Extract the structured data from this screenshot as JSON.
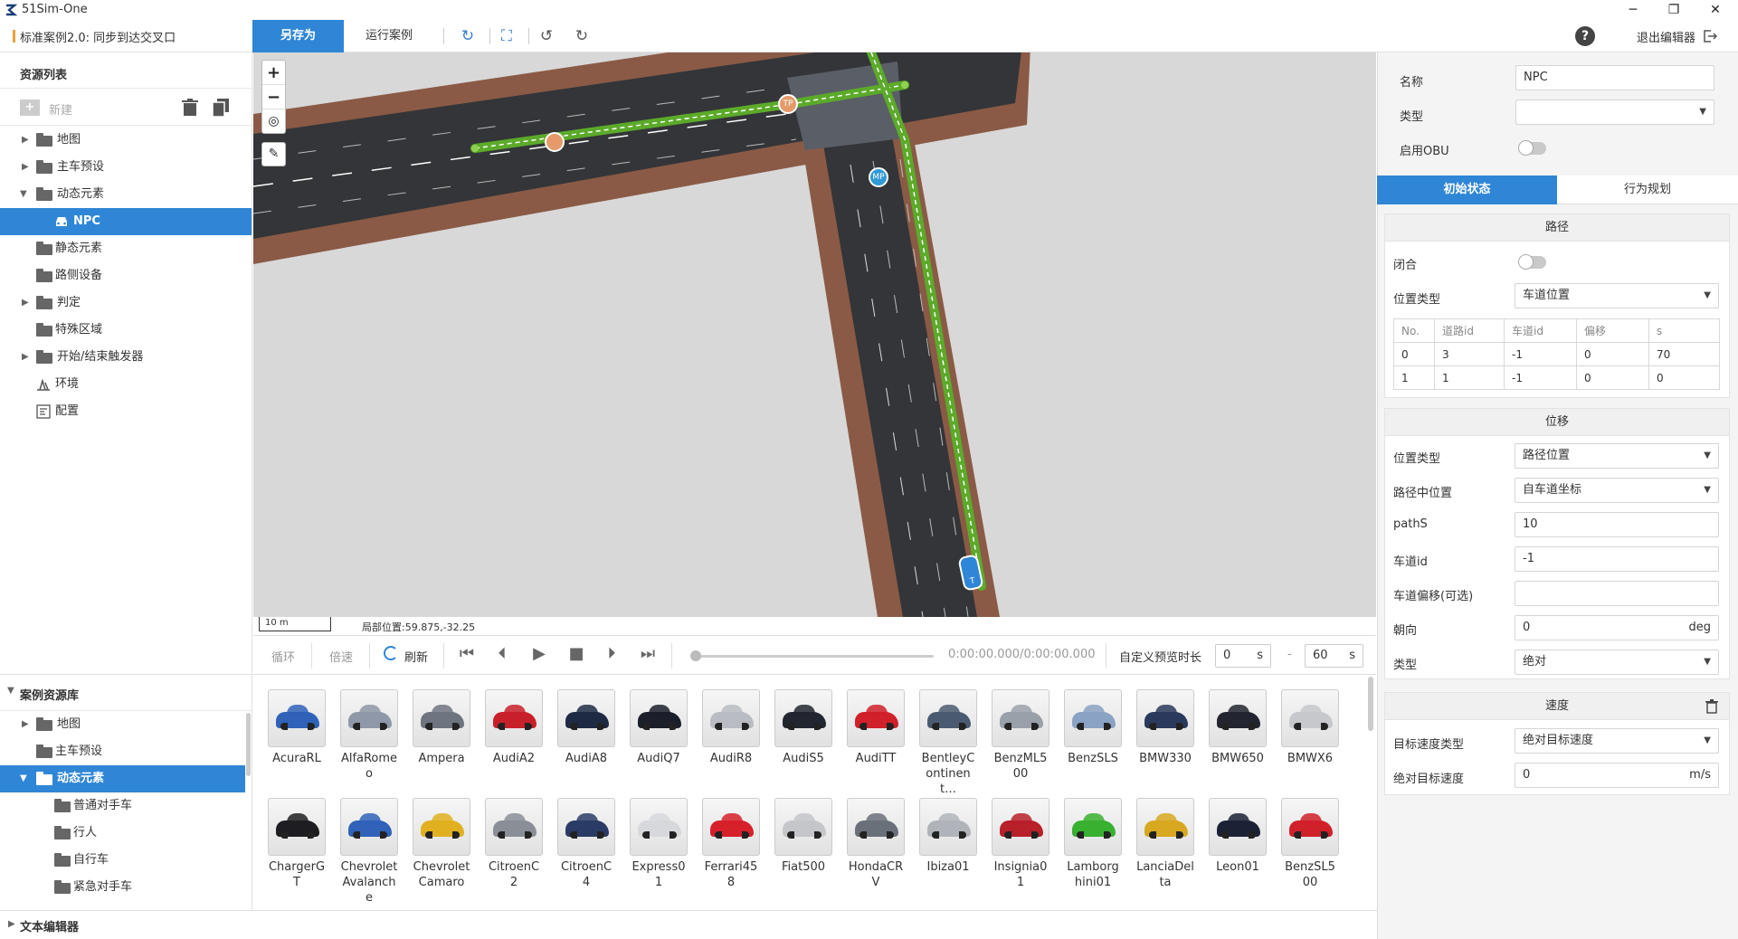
{
  "app": {
    "title": "51Sim-One",
    "case_title": "标准案例2.0: 同步到达交叉口"
  },
  "window": {
    "minimize": "─",
    "restore": "❐",
    "close": "✕"
  },
  "toolbar": {
    "save_as": "另存为",
    "run_case": "运行案例",
    "exit_editor": "退出编辑器",
    "help": "?"
  },
  "resource_list": {
    "title": "资源列表",
    "new": "新建",
    "items": [
      {
        "label": "地图",
        "expandable": true
      },
      {
        "label": "主车预设",
        "expandable": true
      },
      {
        "label": "动态元素",
        "expanded": true
      },
      {
        "label": "NPC",
        "selected": true
      },
      {
        "label": "静态元素"
      },
      {
        "label": "路侧设备"
      },
      {
        "label": "判定",
        "expandable": true
      },
      {
        "label": "特殊区域"
      },
      {
        "label": "开始/结束触发器",
        "expandable": true
      },
      {
        "label": "环境"
      },
      {
        "label": "配置"
      }
    ]
  },
  "case_library": {
    "title": "案例资源库",
    "items": [
      {
        "label": "地图"
      },
      {
        "label": "主车预设"
      },
      {
        "label": "动态元素",
        "selected": true
      },
      {
        "label": "普通对手车"
      },
      {
        "label": "行人"
      },
      {
        "label": "自行车"
      },
      {
        "label": "紧急对手车"
      }
    ]
  },
  "text_editor": {
    "label": "文本编辑器"
  },
  "map": {
    "zoom_in": "+",
    "zoom_out": "−",
    "scale_label": "10 m",
    "local_position": "局部位置:59.875,-32.25",
    "markers": {
      "tp": "TP",
      "mp": "MP",
      "npc": "T"
    }
  },
  "playback": {
    "loop": "循环",
    "speed": "倍速",
    "refresh": "刷新",
    "time": "0:00:00.000/0:00:00.000",
    "custom_preview": "自定义预览时长",
    "start": "0",
    "end": "60",
    "unit": "s",
    "dash": "-"
  },
  "vehicles": [
    {
      "name": "AcuraRL",
      "color": "#2f62b8"
    },
    {
      "name": "AlfaRomeo",
      "color": "#8e98a8"
    },
    {
      "name": "Ampera",
      "color": "#6e7480"
    },
    {
      "name": "AudiA2",
      "color": "#c8202a"
    },
    {
      "name": "AudiA8",
      "color": "#1e2a44"
    },
    {
      "name": "AudiQ7",
      "color": "#1b1f2a"
    },
    {
      "name": "AudiR8",
      "color": "#b9bcc2"
    },
    {
      "name": "AudiS5",
      "color": "#222630"
    },
    {
      "name": "AudiTT",
      "color": "#d0202a"
    },
    {
      "name": "BentleyContinent…",
      "color": "#4a5a70"
    },
    {
      "name": "BenzML500",
      "color": "#9aa0aa"
    },
    {
      "name": "BenzSLS",
      "color": "#8aa2c4"
    },
    {
      "name": "BMW330",
      "color": "#2a3a5c"
    },
    {
      "name": "BMW650",
      "color": "#222430"
    },
    {
      "name": "BMWX6",
      "color": "#c6c8cc"
    },
    {
      "name": "ChargerGT",
      "color": "#1e1e22"
    },
    {
      "name": "Chevrolet Avalanche",
      "color": "#2f62b8"
    },
    {
      "name": "Chevrolet Camaro",
      "color": "#e0b020"
    },
    {
      "name": "CitroenC2",
      "color": "#8a8e96"
    },
    {
      "name": "CitroenC4",
      "color": "#2a3c66"
    },
    {
      "name": "Express01",
      "color": "#d6d8dc"
    },
    {
      "name": "Ferrari458",
      "color": "#d6202a"
    },
    {
      "name": "Fiat500",
      "color": "#c4c6ca"
    },
    {
      "name": "HondaCRV",
      "color": "#6a707a"
    },
    {
      "name": "Ibiza01",
      "color": "#b0b4ba"
    },
    {
      "name": "Insignia01",
      "color": "#b8202a"
    },
    {
      "name": "Lamborghini01",
      "color": "#38b030"
    },
    {
      "name": "LanciaDelta",
      "color": "#d8a820"
    },
    {
      "name": "Leon01",
      "color": "#1c2236"
    },
    {
      "name": "BenzSL500",
      "color": "#d0202a"
    }
  ],
  "properties": {
    "name_label": "名称",
    "name_value": "NPC",
    "type_label": "类型",
    "type_value": "",
    "obu_label": "启用OBU",
    "tabs": {
      "initial": "初始状态",
      "behavior": "行为规划"
    },
    "path": {
      "title": "路径",
      "closed_label": "闭合",
      "pos_type_label": "位置类型",
      "pos_type_value": "车道位置",
      "columns": [
        "No.",
        "道路id",
        "车道id",
        "偏移",
        "s"
      ],
      "rows": [
        [
          "0",
          "3",
          "-1",
          "0",
          "70"
        ],
        [
          "1",
          "1",
          "-1",
          "0",
          "0"
        ]
      ]
    },
    "displacement": {
      "title": "位移",
      "pos_type_label": "位置类型",
      "pos_type_value": "路径位置",
      "path_pos_label": "路径中位置",
      "path_pos_value": "自车道坐标",
      "paths_label": "pathS",
      "paths_value": "10",
      "lane_label": "车道id",
      "lane_value": "-1",
      "offset_label": "车道偏移(可选)",
      "offset_value": "",
      "heading_label": "朝向",
      "heading_value": "0",
      "heading_unit": "deg",
      "type_label": "类型",
      "type_value": "绝对"
    },
    "speed": {
      "title": "速度",
      "target_type_label": "目标速度类型",
      "target_type_value": "绝对目标速度",
      "abs_target_label": "绝对目标速度",
      "abs_target_value": "0",
      "unit": "m/s"
    }
  }
}
